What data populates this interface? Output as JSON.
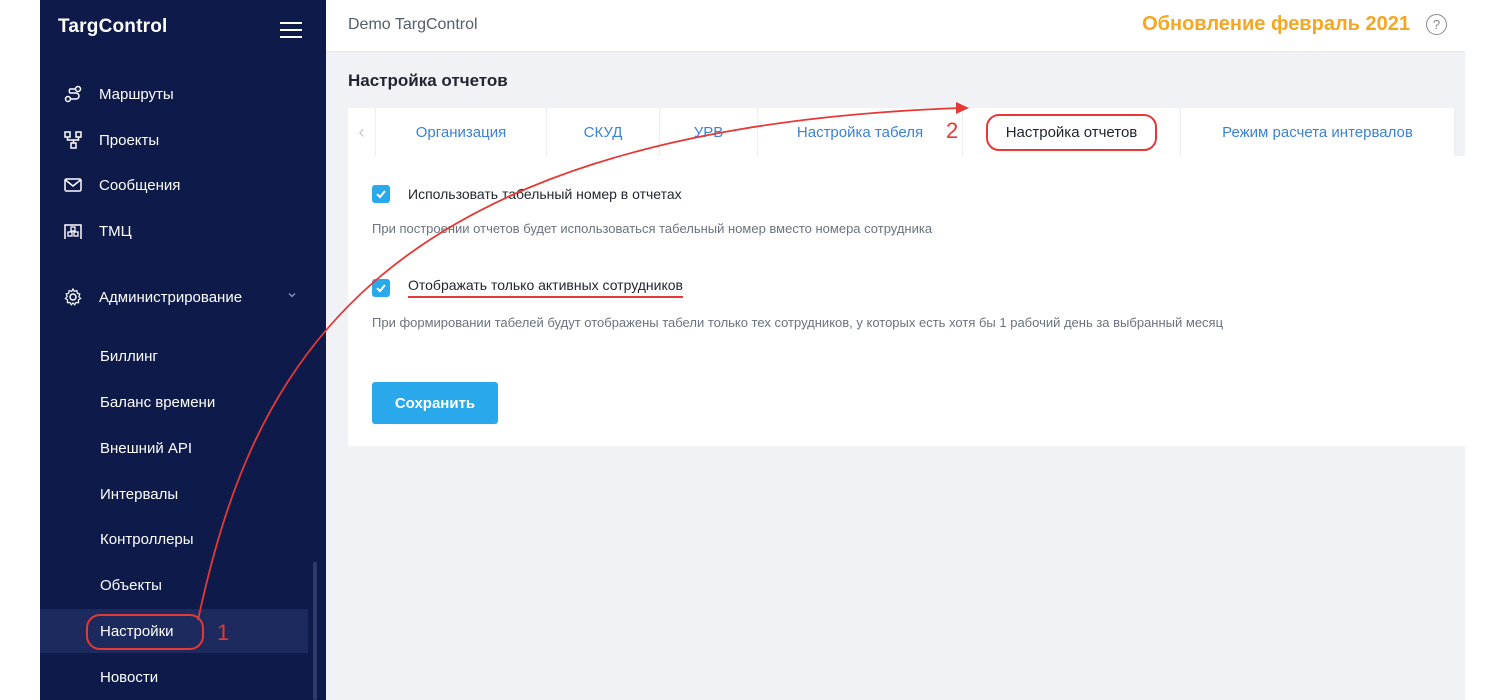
{
  "sidebar": {
    "brand": "TargControl",
    "items": [
      {
        "label": "Маршруты",
        "icon": "route-icon"
      },
      {
        "label": "Проекты",
        "icon": "projects-icon"
      },
      {
        "label": "Сообщения",
        "icon": "mail-icon"
      },
      {
        "label": "ТМЦ",
        "icon": "warehouse-icon"
      },
      {
        "label": "Администрирование",
        "icon": "gear-icon"
      }
    ],
    "sub_items": [
      "Биллинг",
      "Баланс времени",
      "Внешний API",
      "Интервалы",
      "Контроллеры",
      "Объекты",
      "Настройки",
      "Новости"
    ],
    "active_sub_item": "Настройки"
  },
  "header": {
    "app_name": "Demo TargControl",
    "update_label": "Обновление февраль 2021",
    "help_icon": "question-circle-icon"
  },
  "page": {
    "title": "Настройка отчетов",
    "tabs": [
      "Организация",
      "СКУД",
      "УРВ",
      "Настройка табеля",
      "Настройка отчетов",
      "Режим расчета интервалов"
    ],
    "active_tab": "Настройка отчетов"
  },
  "settings": {
    "option1": {
      "label": "Использовать табельный номер в отчетах",
      "hint": "При построении отчетов будет использоваться табельный номер вместо номера сотрудника",
      "checked": true
    },
    "option2": {
      "label": "Отображать только активных сотрудников",
      "hint": "При формировании табелей будут отображены табели только тех сотрудников, у которых есть хотя бы 1 рабочий день за выбранный месяц",
      "checked": true
    },
    "save_label": "Сохранить"
  },
  "annotations": {
    "step1": "1",
    "step2": "2",
    "color": "#e53935"
  },
  "colors": {
    "sidebar_bg": "#0e1b4a",
    "accent": "#29a8eb",
    "update_color": "#f5a623",
    "tab_link": "#3b82d6"
  }
}
